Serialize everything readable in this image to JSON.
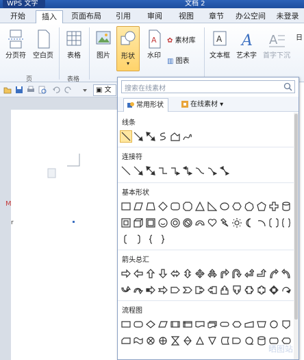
{
  "titlebar": {
    "app": "WPS 文字",
    "doc": "文档 2"
  },
  "menu": [
    "开始",
    "插入",
    "页面布局",
    "引用",
    "审阅",
    "视图",
    "章节",
    "办公空间",
    "未登录"
  ],
  "ribbon": {
    "buttons": [
      "分页符",
      "空白页",
      "表格",
      "图片",
      "形状",
      "水印",
      "素材库",
      "图表",
      "文本框",
      "艺术字",
      "首字下沉",
      "日"
    ],
    "groups": [
      "页",
      "表格"
    ]
  },
  "panel": {
    "search_placeholder": "搜索在线素材",
    "tabs": [
      "常用形状",
      "在线素材"
    ],
    "categories": [
      "线条",
      "连接符",
      "基本形状",
      "箭头总汇",
      "流程图"
    ]
  },
  "doc": {
    "fragment": "r",
    "fragment2": "M"
  },
  "watermark": "晒图站",
  "colors": {
    "titlebar": "#1d4e9e",
    "accent": "#ffd36b",
    "panel_border": "#8aa0c4"
  }
}
